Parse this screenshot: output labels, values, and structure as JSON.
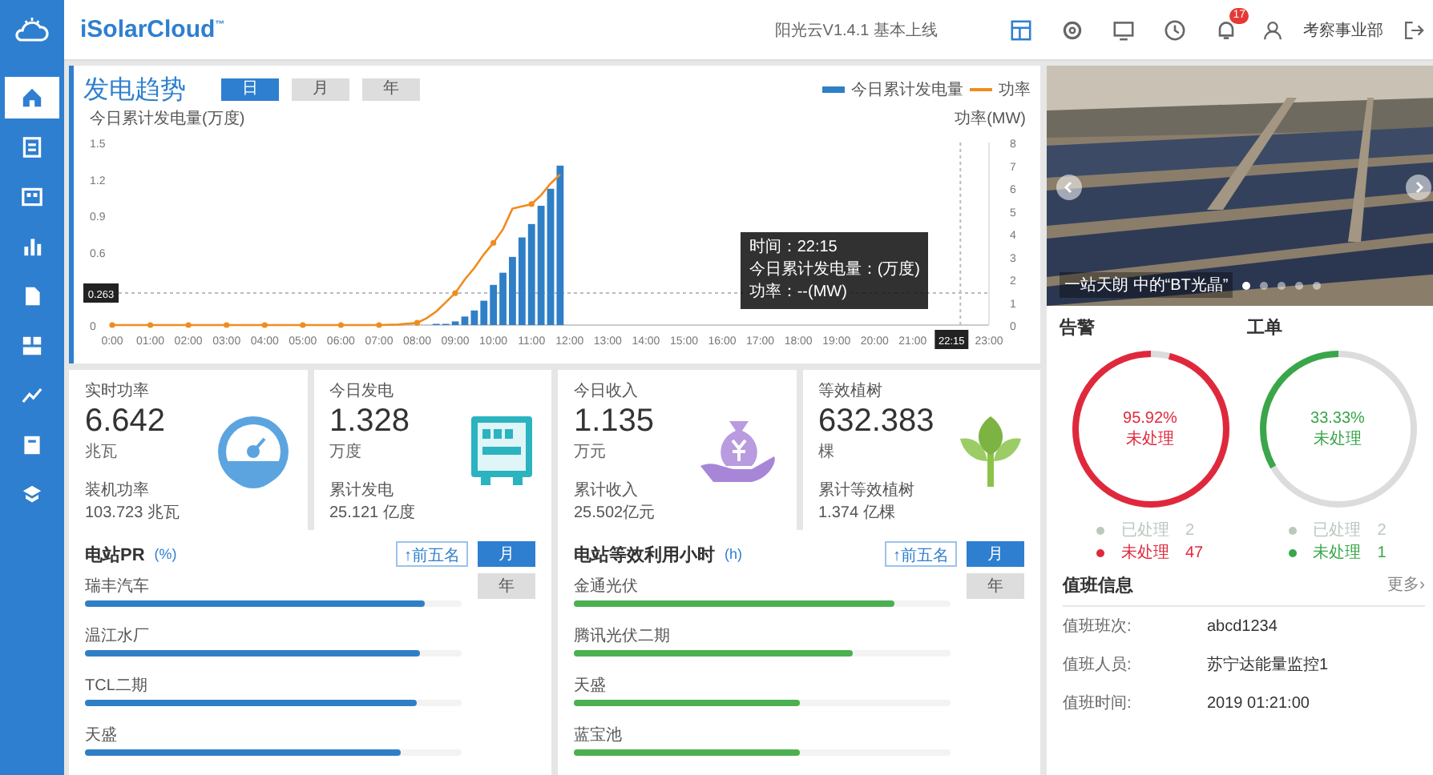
{
  "sidebar": {
    "items": [
      {
        "selected": true
      },
      {
        "selected": false
      },
      {
        "selected": false
      },
      {
        "selected": false
      },
      {
        "selected": false
      },
      {
        "selected": false
      },
      {
        "selected": false
      },
      {
        "selected": false
      },
      {
        "selected": false
      }
    ]
  },
  "topbar": {
    "logo": "iSolarCloud$^{™}$",
    "version": "阳光云V1.4.1 基本上线",
    "toolbar": [
      {
        "selected": true
      },
      {
        "selected": false
      },
      {
        "selected": false
      },
      {
        "selected": false
      },
      {
        "selected": false,
        "badge": "17"
      }
    ],
    "user": "考察事业部"
  },
  "trend": {
    "title": "发电趋势",
    "tabs": [
      {
        "label": "日",
        "selected": true
      },
      {
        "label": "月",
        "selected": false
      },
      {
        "label": "年",
        "selected": false
      }
    ],
    "chart_data": {
      "type": "bar",
      "ylabel": "今日累计发电量(万度)",
      "x": [
        8.5,
        8.75,
        9,
        9.25,
        9.5,
        9.75,
        10,
        10.25,
        10.5,
        10.75,
        11,
        11.25,
        11.5,
        11.75
      ],
      "series": [
        {
          "name": "今日累计发电量",
          "color": "#2f7fc6",
          "values": [
            0.01,
            0.01,
            0.03,
            0.07,
            0.12,
            0.2,
            0.33,
            0.43,
            0.56,
            0.72,
            0.83,
            0.98,
            1.12,
            1.31
          ]
        }
      ],
      "xlim": [
        0,
        23
      ],
      "ylim": [
        0,
        1.5
      ],
      "xticks": [
        {
          "value": 0,
          "label": "0:00"
        },
        {
          "value": 1,
          "label": "01:00"
        },
        {
          "value": 2,
          "label": "02:00"
        },
        {
          "value": 3,
          "label": "03:00"
        },
        {
          "value": 4,
          "label": "04:00"
        },
        {
          "value": 5,
          "label": "05:00"
        },
        {
          "value": 6,
          "label": "06:00"
        },
        {
          "value": 7,
          "label": "07:00"
        },
        {
          "value": 8,
          "label": "08:00"
        },
        {
          "value": 9,
          "label": "09:00"
        },
        {
          "value": 10,
          "label": "10:00"
        },
        {
          "value": 11,
          "label": "11:00"
        },
        {
          "value": 12,
          "label": "12:00"
        },
        {
          "value": 13,
          "label": "13:00"
        },
        {
          "value": 14,
          "label": "14:00"
        },
        {
          "value": 15,
          "label": "15:00"
        },
        {
          "value": 16,
          "label": "16:00"
        },
        {
          "value": 17,
          "label": "17:00"
        },
        {
          "value": 18,
          "label": "18:00"
        },
        {
          "value": 19,
          "label": "19:00"
        },
        {
          "value": 20,
          "label": "20:00"
        },
        {
          "value": 21,
          "label": "21:00"
        },
        {
          "value": 23,
          "label": "23:00"
        }
      ],
      "yticks": [
        {
          "value": 0,
          "label": "0"
        },
        {
          "value": 0.6,
          "label": "0.6"
        },
        {
          "value": 0.9,
          "label": "0.9"
        },
        {
          "value": 1.2,
          "label": "1.2"
        },
        {
          "value": 1.5,
          "label": "1.5"
        }
      ],
      "ref_lines": [
        {
          "axis": "y",
          "value": 0.263
        },
        {
          "axis": "x",
          "value": 22.25
        }
      ]
    },
    "power": {
      "chart_data": {
        "type": "line",
        "ylabel": "功率(MW)",
        "x": [
          0,
          1,
          2,
          3,
          4,
          5,
          6,
          7,
          7.5,
          8,
          8.25,
          8.5,
          8.75,
          9,
          9.25,
          9.5,
          9.75,
          10,
          10.25,
          10.5,
          10.75,
          11,
          11.25,
          11.5,
          11.75
        ],
        "series": [
          {
            "name": "功率",
            "color": "#f08c1e",
            "values": [
              0,
              0,
              0,
              0,
              0,
              0,
              0,
              0,
              0.02,
              0.1,
              0.3,
              0.6,
              1.0,
              1.4,
              2.0,
              2.5,
              3.1,
              3.6,
              4.2,
              5.1,
              5.2,
              5.3,
              5.7,
              6.2,
              6.6
            ]
          }
        ],
        "xlim": [
          0,
          23
        ],
        "ylim": [
          0,
          8
        ],
        "yticks": [
          0,
          1,
          2,
          3,
          4,
          5,
          6,
          7,
          8
        ]
      }
    },
    "cursor": {
      "x_label": "22:15",
      "y_label": "0.263",
      "tooltip": [
        "时间：22:15",
        "今日累计发电量：(万度)",
        "功率：--(MW)"
      ]
    }
  },
  "kpis": [
    {
      "label": "实时功率",
      "value": "6.642",
      "unit": "兆瓦",
      "sub_label": "装机功率",
      "sub_value": "103.723 兆瓦"
    },
    {
      "label": "今日发电",
      "value": "1.328",
      "unit": "万度",
      "sub_label": "累计发电",
      "sub_value": "25.121 亿度"
    },
    {
      "label": "今日收入",
      "value": "1.135",
      "unit": "万元",
      "sub_label": "累计收入",
      "sub_value": "25.502亿元"
    },
    {
      "label": "等效植树",
      "value": "632.383",
      "unit": "棵",
      "sub_label": "累计等效植树",
      "sub_value": "1.374 亿棵"
    }
  ],
  "rankings": [
    {
      "title": "电站PR",
      "unit": "(%)",
      "top_button": "↑前五名",
      "periods": [
        {
          "label": "月",
          "selected": true
        },
        {
          "label": "年",
          "selected": false
        }
      ],
      "items": [
        {
          "name": "瑞丰汽车",
          "level": 0.9
        },
        {
          "name": "温江水厂",
          "level": 0.89
        },
        {
          "name": "TCL二期",
          "level": 0.88
        },
        {
          "name": "天盛",
          "level": 0.84
        }
      ]
    },
    {
      "title": "电站等效利用小时",
      "unit": "(h)",
      "top_button": "↑前五名",
      "periods": [
        {
          "label": "月",
          "selected": true
        },
        {
          "label": "年",
          "selected": false
        }
      ],
      "items": [
        {
          "name": "金通光伏",
          "level": 0.85
        },
        {
          "name": "腾讯光伏二期",
          "level": 0.74
        },
        {
          "name": "天盛",
          "level": 0.6
        },
        {
          "name": "蓝宝池",
          "level": 0.6
        }
      ]
    }
  ],
  "photo": {
    "kind": "picture",
    "caption": "一站天朗 中的“BT光晶”",
    "dots": [
      {
        "selected": true
      },
      {
        "selected": false
      },
      {
        "selected": false
      },
      {
        "selected": false
      },
      {
        "selected": false
      }
    ]
  },
  "status": [
    {
      "title": "告警",
      "percent": "95.92%",
      "center_label": "未处理",
      "level": 0.9592,
      "color": "#e0283c",
      "legend": [
        {
          "label": "已处理",
          "count": "2",
          "color": "#b8c9bd"
        },
        {
          "label": "未处理",
          "count": "47",
          "color": "#e0283c"
        }
      ]
    },
    {
      "title": "工单",
      "percent": "33.33%",
      "center_label": "未处理",
      "level": 0.3333,
      "color": "#3aa64a",
      "legend": [
        {
          "label": "已处理",
          "count": "2",
          "color": "#b8c9bd"
        },
        {
          "label": "未处理",
          "count": "1",
          "color": "#3aa64a"
        }
      ]
    }
  ],
  "duty": {
    "title": "值班信息",
    "more": "更多›",
    "rows": [
      {
        "label": "值班班次:",
        "value": "abcd1234"
      },
      {
        "label": "值班人员:",
        "value": "苏宁达能量监控1"
      },
      {
        "label": "值班时间:",
        "value": "2019 01:21:00"
      }
    ]
  }
}
